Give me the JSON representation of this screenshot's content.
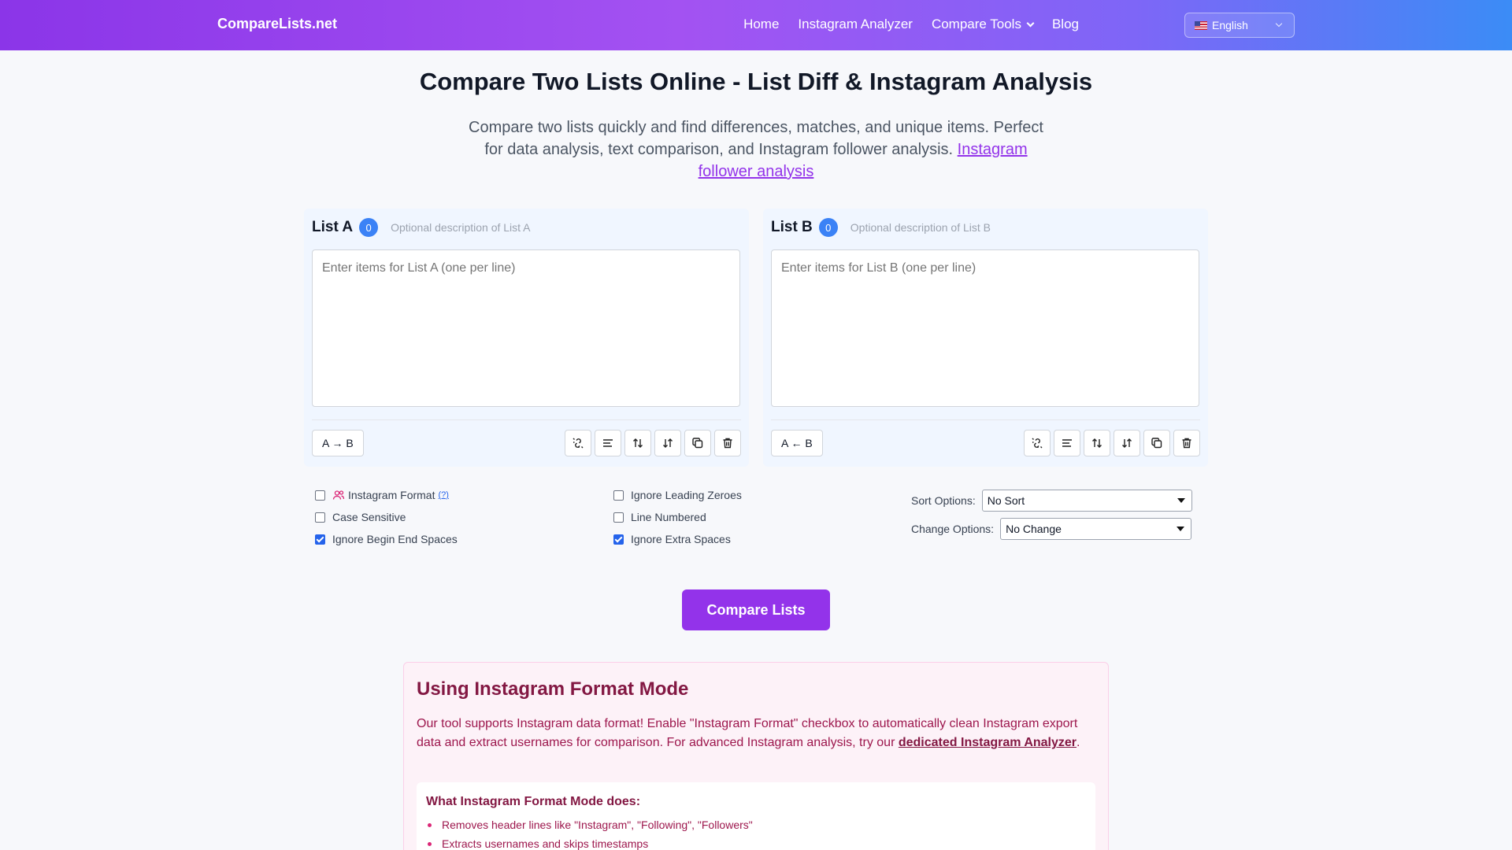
{
  "nav": {
    "brand": "CompareLists.net",
    "links": [
      "Home",
      "Instagram Analyzer",
      "Compare Tools",
      "Blog"
    ],
    "language": "English"
  },
  "hero": {
    "title": "Compare Two Lists Online - List Diff & Instagram Analysis",
    "subtitle": "Compare two lists quickly and find differences, matches, and unique items. Perfect for data analysis, text comparison, and Instagram follower analysis.",
    "subtitle_link": "Instagram follower analysis"
  },
  "listA": {
    "label": "List A",
    "count": "0",
    "description_placeholder": "Optional description of List A",
    "placeholder": "Enter items for List A (one per line)",
    "transfer": "A → B"
  },
  "listB": {
    "label": "List B",
    "count": "0",
    "description_placeholder": "Optional description of List B",
    "placeholder": "Enter items for List B (one per line)",
    "transfer": "A ← B"
  },
  "tool_icons": [
    "link-break-icon",
    "align-left-icon",
    "sort-icon",
    "reverse-sort-icon",
    "copy-icon",
    "trash-icon"
  ],
  "options": {
    "instagram_format": {
      "label": "Instagram Format",
      "help": "(?)",
      "checked": false
    },
    "case_sensitive": {
      "label": "Case Sensitive",
      "checked": false
    },
    "ignore_begin_end_spaces": {
      "label": "Ignore Begin End Spaces",
      "checked": true
    },
    "ignore_leading_zeroes": {
      "label": "Ignore Leading Zeroes",
      "checked": false
    },
    "line_numbered": {
      "label": "Line Numbered",
      "checked": false
    },
    "ignore_extra_spaces": {
      "label": "Ignore Extra Spaces",
      "checked": true
    },
    "sort_label": "Sort Options:",
    "sort_value": "No Sort",
    "change_label": "Change Options:",
    "change_value": "No Change"
  },
  "compare_button": "Compare Lists",
  "instagram_info": {
    "title": "Using Instagram Format Mode",
    "text": "Our tool supports Instagram data format! Enable \"Instagram Format\" checkbox to automatically clean Instagram export data and extract usernames for comparison. For advanced Instagram analysis, try our",
    "link": "dedicated Instagram Analyzer",
    "inner_title": "What Instagram Format Mode does:",
    "items": [
      "Removes header lines like \"Instagram\", \"Following\", \"Followers\"",
      "Extracts usernames and skips timestamps"
    ]
  },
  "colors": {
    "accent": "#9333ea",
    "badge": "#3b82f6",
    "info_text": "#9d174d"
  }
}
